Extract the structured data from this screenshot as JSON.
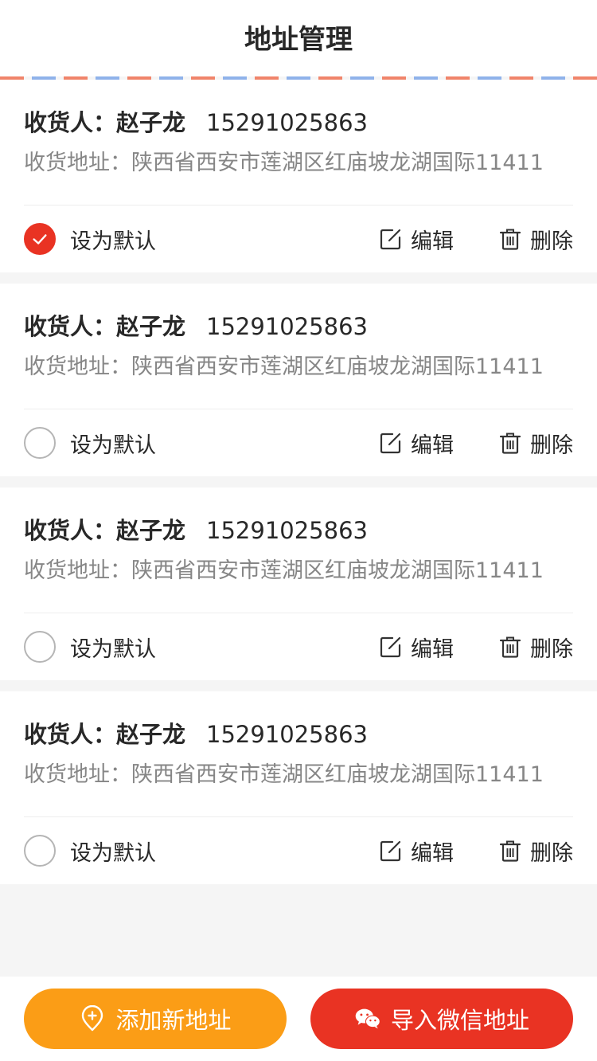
{
  "header": {
    "title": "地址管理"
  },
  "addresses": [
    {
      "receiver_label": "收货人：",
      "name": "赵子龙",
      "phone": "15291025863",
      "address_label": "收货地址：",
      "address": "陕西省西安市莲湖区红庙坡龙湖国际11411",
      "is_default": true,
      "default_label": "设为默认",
      "edit_label": "编辑",
      "delete_label": "删除"
    },
    {
      "receiver_label": "收货人：",
      "name": "赵子龙",
      "phone": "15291025863",
      "address_label": "收货地址：",
      "address": "陕西省西安市莲湖区红庙坡龙湖国际11411",
      "is_default": false,
      "default_label": "设为默认",
      "edit_label": "编辑",
      "delete_label": "删除"
    },
    {
      "receiver_label": "收货人：",
      "name": "赵子龙",
      "phone": "15291025863",
      "address_label": "收货地址：",
      "address": "陕西省西安市莲湖区红庙坡龙湖国际11411",
      "is_default": false,
      "default_label": "设为默认",
      "edit_label": "编辑",
      "delete_label": "删除"
    },
    {
      "receiver_label": "收货人：",
      "name": "赵子龙",
      "phone": "15291025863",
      "address_label": "收货地址：",
      "address": "陕西省西安市莲湖区红庙坡龙湖国际11411",
      "is_default": false,
      "default_label": "设为默认",
      "edit_label": "编辑",
      "delete_label": "删除"
    }
  ],
  "footer": {
    "add_label": "添加新地址",
    "add_icon": "location-plus-icon",
    "wechat_label": "导入微信地址",
    "wechat_icon": "wechat-icon"
  },
  "colors": {
    "accent_red": "#e93323",
    "accent_orange": "#fb9d16"
  }
}
